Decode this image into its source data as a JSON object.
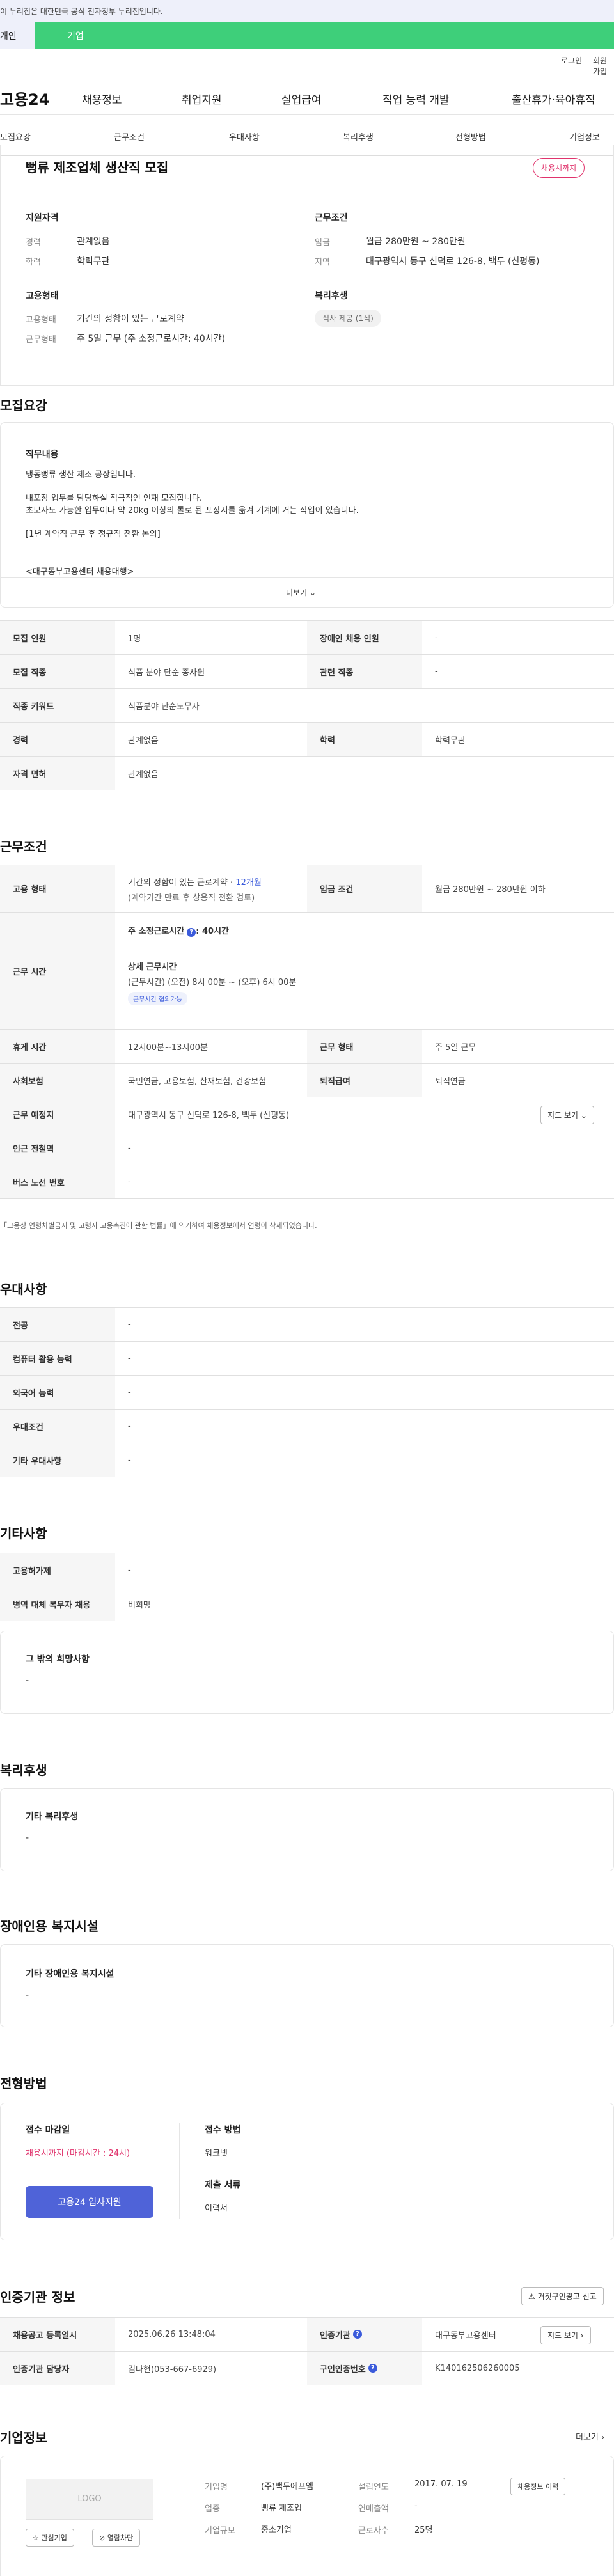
{
  "gov_banner": "이 누리집은 대한민국 공식 전자정부 누리집입니다.",
  "top_tabs": [
    "개인",
    "기업"
  ],
  "util": {
    "login": "로그인",
    "join": "회원가입"
  },
  "brand": "고용24",
  "gnb": [
    "채용정보",
    "취업지원",
    "실업급여",
    "직업 능력 개발",
    "출산휴가·육아휴직"
  ],
  "snb": [
    "모집요강",
    "근무조건",
    "우대사항",
    "복리후생",
    "전형방법",
    "기업정보"
  ],
  "job": {
    "title": "뻥류 제조업체 생산직 모집",
    "status": "채용시까지"
  },
  "summary": {
    "qual_title": "지원자격",
    "career_l": "경력",
    "career_v": "관계없음",
    "edu_l": "학력",
    "edu_v": "학력무관",
    "emp_title": "고용형태",
    "emptype_l": "고용형태",
    "emptype_v": "기간의 정함이 있는 근로계약",
    "worktype_l": "근무형태",
    "worktype_v": "주 5일 근무 (주 소정근로시간: 40시간)",
    "cond_title": "근무조건",
    "wage_l": "임금",
    "wage_v": "월급 280만원 ~ 280만원",
    "area_l": "지역",
    "area_v": "대구광역시 동구 신덕로 126-8, 백두 (신평동)",
    "welfare_title": "복리후생",
    "welfare_pill": "식사 제공 (1식)"
  },
  "recruit": {
    "heading": "모집요강",
    "duty_title": "직무내용",
    "lines": [
      "냉동뻥류 생산 제조 공장입니다.",
      "내포장 업무를 담당하실 적극적인 인재 모집합니다.",
      "초보자도 가능한 업무이나 약 20kg 이상의 롤로 된 포장지를 옮겨 기계에 거는 작업이 있습니다.",
      "[1년 계약직 근무 후 정규직 전환 논의]",
      "<대구동부고용센터 채용대행>"
    ],
    "more": "더보기"
  },
  "recruit_table": [
    {
      "k1": "모집 인원",
      "v1": "1명",
      "k2": "장애인 채용 인원",
      "v2": "-"
    },
    {
      "k1": "모집 직종",
      "v1": "식품 분야 단순 종사원",
      "k2": "관련 직종",
      "v2": "-"
    },
    {
      "k1": "직종 키워드",
      "v1": "식품분야 단순노무자"
    },
    {
      "k1": "경력",
      "v1": "관계없음",
      "k2": "학력",
      "v2": "학력무관"
    },
    {
      "k1": "자격 면허",
      "v1": "관계없음"
    }
  ],
  "work": {
    "heading": "근무조건",
    "emp_k": "고용 형태",
    "emp_v1": "기간의 정함이 있는 근로계약 · ",
    "emp_v1b": "12개월",
    "emp_v2": "(계약기간 만료 후 상용직 전환 검토)",
    "wage_k": "임금 조건",
    "wage_v": "월급 280만원 ~ 280만원 이하",
    "time_k": "근무 시간",
    "time_a": "주 소정근로시간",
    "time_b": ": 40시간",
    "time_c": "상세 근무시간",
    "time_d": "(근무시간) (오전) 8시 00분 ~ (오후) 6시 00분",
    "time_e": "근무시간 협의가능",
    "rest_k": "휴게 시간",
    "rest_v": "12시00분~13시00분",
    "form_k": "근무 형태",
    "form_v": "주 5일 근무",
    "ins_k": "사회보험",
    "ins_v": "국민연금, 고용보험, 산재보험, 건강보험",
    "sev_k": "퇴직급여",
    "sev_v": "퇴직연금",
    "place_k": "근무 예정지",
    "place_v": "대구광역시 동구 신덕로 126-8, 백두 (신평동)",
    "map": "지도 보기",
    "subway_k": "인근 전철역",
    "subway_v": "-",
    "bus_k": "버스 노선 번호",
    "bus_v": "-",
    "note": "「고용상 연령차별금지 및 고령자 고용촉진에 관한 법률」에 의거하여 채용정보에서 연령이 삭제되었습니다."
  },
  "pref": {
    "heading": "우대사항",
    "rows": [
      {
        "k": "전공",
        "v": "-"
      },
      {
        "k": "컴퓨터 활용 능력",
        "v": "-"
      },
      {
        "k": "외국어 능력",
        "v": "-"
      },
      {
        "k": "우대조건",
        "v": "-"
      },
      {
        "k": "기타 우대사항",
        "v": "-"
      }
    ]
  },
  "etc": {
    "heading": "기타사항",
    "rows": [
      {
        "k": "고용허가제",
        "v": "-"
      },
      {
        "k": "병역 대체 복무자 채용",
        "v": "비희망"
      }
    ],
    "box_t": "그 밖의 희망사항",
    "box_v": "-"
  },
  "welfare": {
    "heading": "복리후생",
    "box_t": "기타 복리후생",
    "box_v": "-"
  },
  "disab": {
    "heading": "장애인용 복지시설",
    "box_t": "기타 장애인용 복지시설",
    "box_v": "-"
  },
  "process": {
    "heading": "전형방법",
    "deadline_t": "접수 마감일",
    "deadline_v": "채용시까지 (마감시간 : 24시)",
    "apply": "고용24 입사지원",
    "method_t": "접수 방법",
    "method_v": "워크넷",
    "docs_t": "제출 서류",
    "docs_v": "이력서"
  },
  "cert": {
    "heading": "인증기관 정보",
    "report": "거짓구인광고 신고",
    "r1k1": "채용공고 등록일시",
    "r1v1": "2025.06.26 13:48:04",
    "r1k2": "인증기관",
    "r1v2": "대구동부고용센터",
    "map": "지도 보기",
    "r2k1": "인증기관 담당자",
    "r2v1": "김나현(053-667-6929)",
    "r2k2": "구인인증번호",
    "r2v2": "K140162506260005"
  },
  "company": {
    "heading": "기업정보",
    "more": "더보기",
    "logo": "LOGO",
    "fav": "관심기업",
    "block": "열람차단",
    "name_k": "기업명",
    "name_v": "(주)백두에프엠",
    "ind_k": "업종",
    "ind_v": "뻥류 제조업",
    "size_k": "기업규모",
    "size_v": "중소기업",
    "year_k": "설립연도",
    "year_v": "2017. 07. 19",
    "rev_k": "연매출액",
    "rev_v": "-",
    "emp_k": "근로자수",
    "emp_v": "25명",
    "history": "채용정보 이력"
  }
}
